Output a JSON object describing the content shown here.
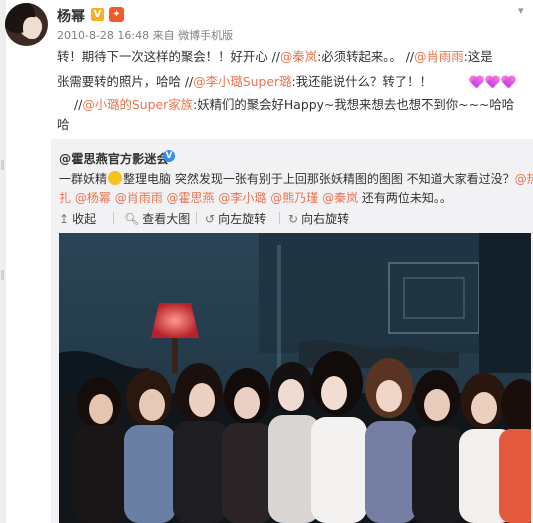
{
  "post": {
    "username": "杨幂",
    "meta": "2010-8-28 16:48 来自 微博手机版",
    "lines": [
      [
        {
          "t": "转！期待下一次这样的聚会！！好开心 //",
          "c": "plain"
        },
        {
          "t": "@秦岚",
          "c": "link"
        },
        {
          "t": ":必须转起来。。 //",
          "c": "plain"
        },
        {
          "t": "@肖雨雨",
          "c": "link"
        },
        {
          "t": ":这是",
          "c": "plain"
        }
      ],
      [
        {
          "t": "张需要转的照片，哈哈 //",
          "c": "plain"
        },
        {
          "t": "@李小璐Super璐",
          "c": "link"
        },
        {
          "t": ":我还能说什么？转了！！",
          "c": "plain"
        }
      ],
      [
        {
          "t": "//",
          "c": "plain"
        },
        {
          "t": "@小璐的Super家族",
          "c": "link"
        },
        {
          "t": ":妖精们的聚会好Happy~我想来想去也想不到你~~~哈哈",
          "c": "plain"
        }
      ],
      [
        {
          "t": "哈",
          "c": "plain"
        }
      ]
    ]
  },
  "repost": {
    "author": "@霍思燕官方影迷会",
    "lines": [
      [
        {
          "t": "一群妖精",
          "c": "plain"
        },
        {
          "t": "EMOJI",
          "c": "emoji"
        },
        {
          "t": "整理电脑 突然发现一张有别于上回那张妖精图的图图 不知道大家看过没？",
          "c": "plain"
        },
        {
          "t": "@热依",
          "c": "link"
        }
      ],
      [
        {
          "t": "扎",
          "c": "link"
        },
        {
          "t": " ",
          "c": "plain"
        },
        {
          "t": "@杨幂",
          "c": "link"
        },
        {
          "t": " ",
          "c": "plain"
        },
        {
          "t": "@肖雨雨",
          "c": "link"
        },
        {
          "t": " ",
          "c": "plain"
        },
        {
          "t": "@霍思燕",
          "c": "link"
        },
        {
          "t": " ",
          "c": "plain"
        },
        {
          "t": "@李小璐",
          "c": "link"
        },
        {
          "t": " ",
          "c": "plain"
        },
        {
          "t": "@熊乃瑾",
          "c": "link"
        },
        {
          "t": " ",
          "c": "plain"
        },
        {
          "t": "@秦岚",
          "c": "link"
        },
        {
          "t": " 还有两位未知。。",
          "c": "plain"
        }
      ]
    ],
    "toolbar": {
      "collapse": "收起",
      "view_large": "查看大图",
      "rotate_left": "向左旋转",
      "rotate_right": "向右旋转"
    }
  },
  "colors": {
    "link": "#eb7350",
    "text": "#333333",
    "meta": "#808080",
    "quote_bg": "#f2f2f5",
    "verified_badge": "#2d8df3",
    "vip_badge": "#f6b023"
  },
  "icons": {
    "caret": "chevron-down-icon",
    "avatar": "avatar",
    "collapse": "collapse-icon",
    "view_large": "zoom-icon",
    "rotate_left": "rotate-left-icon",
    "rotate_right": "rotate-right-icon"
  }
}
